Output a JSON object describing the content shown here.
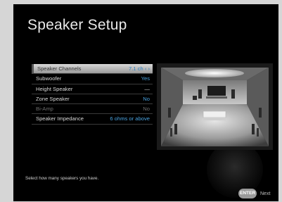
{
  "screen": {
    "title": "Speaker Setup",
    "hint": "Select how many speakers you have.",
    "enter_label": "ENTER",
    "next_label": "Next"
  },
  "menu": {
    "items": [
      {
        "label": "Speaker Channels",
        "value": "7.1 ch ‹ ›",
        "state": "selected"
      },
      {
        "label": "Subwoofer",
        "value": "Yes",
        "state": "normal"
      },
      {
        "label": "Height Speaker",
        "value": "—",
        "state": "normal"
      },
      {
        "label": "Zone Speaker",
        "value": "No",
        "state": "normal"
      },
      {
        "label": "Bi-Amp",
        "value": "No",
        "state": "disabled"
      },
      {
        "label": "Speaker Impedance",
        "value": "6 ohms or above",
        "state": "normal"
      }
    ]
  },
  "preview": {
    "icon": "speaker-layout-room-preview"
  }
}
